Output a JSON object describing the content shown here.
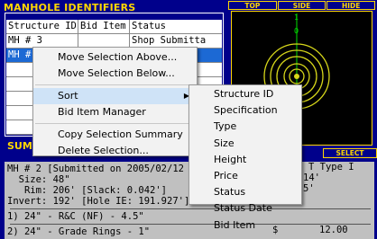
{
  "manhole_panel": {
    "title": "MANHOLE IDENTIFIERS",
    "columns": [
      "Structure ID",
      "Bid Item",
      "Status"
    ],
    "rows": [
      {
        "id": "MH # 3",
        "bid": "",
        "status": "Shop Submitta"
      },
      {
        "id": "MH # 2",
        "bid": "",
        "status": ""
      },
      {
        "id": "",
        "bid": "",
        "status": ""
      },
      {
        "id": "",
        "bid": "",
        "status": ""
      },
      {
        "id": "",
        "bid": "",
        "status": ""
      },
      {
        "id": "",
        "bid": "",
        "status": ""
      },
      {
        "id": "",
        "bid": "",
        "status": ""
      }
    ]
  },
  "summary": {
    "label": "SUMM",
    "lines": [
      "MH # 2 [Submitted on 2005/02/12",
      "  Size: 48\"",
      "   Rim: 206' [Slack: 0.042']",
      "Invert: 192' [Hole IE: 191.927']"
    ],
    "right_fragments": [
      "T Type I",
      "14'",
      "5'"
    ],
    "items": [
      "1) 24\" - R&C (NF) - 4.5\"",
      "2) 24\" - Grade Rings - 1\""
    ],
    "prices": [
      "$",
      "12.00"
    ]
  },
  "viewer": {
    "buttons": [
      "TOP",
      "SIDE",
      "HIDE"
    ],
    "select_label": "SELECT",
    "scale_labels": [
      "1",
      "0"
    ],
    "colors": {
      "rings": "#d6d61a",
      "axis": "#00e000",
      "frame": "#ffd700"
    }
  },
  "context_menu": {
    "items": [
      {
        "label": "Move Selection Above...",
        "has_sub": false
      },
      {
        "label": "Move Selection Below...",
        "has_sub": false
      },
      {
        "sep": true
      },
      {
        "label": "Sort",
        "has_sub": true,
        "highlight": true
      },
      {
        "label": "Bid Item Manager",
        "has_sub": false
      },
      {
        "sep": true
      },
      {
        "label": "Copy Selection Summary",
        "has_sub": false
      },
      {
        "label": "Delete Selection...",
        "has_sub": false
      }
    ]
  },
  "sort_submenu": {
    "items": [
      "Structure ID",
      "Specification",
      "Type",
      "Size",
      "Height",
      "Price",
      "Status",
      "Status Date",
      "Bid Item"
    ]
  }
}
